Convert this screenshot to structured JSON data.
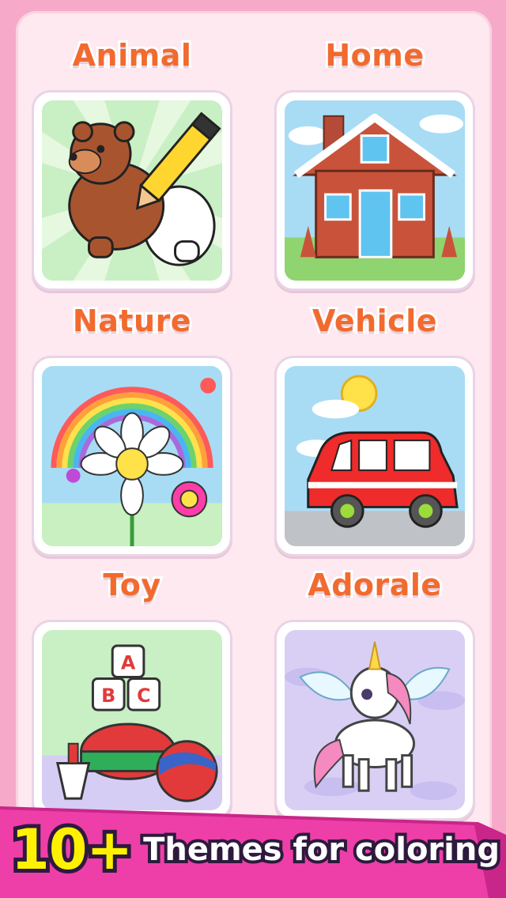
{
  "categories": [
    {
      "label": "Animal"
    },
    {
      "label": "Home"
    },
    {
      "label": "Nature"
    },
    {
      "label": "Vehicle"
    },
    {
      "label": "Toy"
    },
    {
      "label": "Adorale"
    }
  ],
  "banner": {
    "count": "10+",
    "tagline": "Themes for coloring"
  },
  "colors": {
    "background": "#f7a9c9",
    "panel": "#fde9ef",
    "title": "#f26a2e",
    "banner": "#ee3fa8",
    "highlight": "#fff200"
  }
}
